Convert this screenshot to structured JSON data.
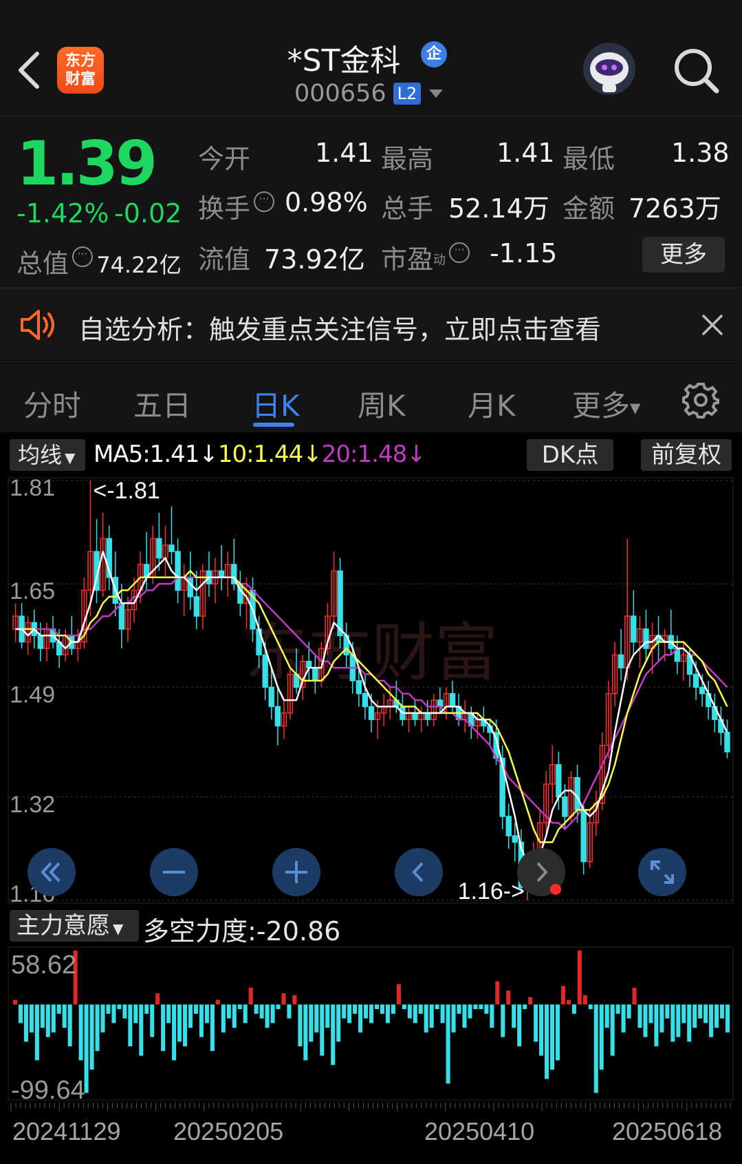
{
  "header": {
    "logo_text_line1": "东方",
    "logo_text_line2": "财富",
    "title": "*ST金科",
    "qi_badge": "企",
    "code": "000656",
    "level_badge": "L2",
    "icons": [
      "back-icon",
      "robot-avatar-icon",
      "search-icon"
    ]
  },
  "quote": {
    "price": "1.39",
    "change_pct": "-1.42%",
    "change": "-0.02",
    "open_label": "今开",
    "open": "1.41",
    "high_label": "最高",
    "high": "1.41",
    "low_label": "最低",
    "low": "1.38",
    "turnover_label": "换手",
    "turnover": "0.98%",
    "volume_label": "总手",
    "volume": "52.14万",
    "amount_label": "金额",
    "amount": "7263万",
    "mktcap_label": "总值",
    "mktcap": "74.22亿",
    "float_label": "流值",
    "float_cap": "73.92亿",
    "pe_label": "市盈",
    "pe_sup": "动",
    "pe": "-1.15",
    "more_button": "更多",
    "colors": {
      "down": "#1ed760",
      "up": "#ff3b30"
    }
  },
  "notice": {
    "text": "自选分析：触发重点关注信号，立即点击查看"
  },
  "tabs": {
    "items": [
      "分时",
      "五日",
      "日K",
      "周K",
      "月K",
      "更多"
    ],
    "active": "日K"
  },
  "chart_toolbar": {
    "ma_select": "均线",
    "ma5": "MA5:1.41↓",
    "ma10": "10:1.44↓",
    "ma20": "20:1.48↓",
    "dk_button": "DK点",
    "adjust_button": "前复权"
  },
  "indicator": {
    "select": "主力意愿",
    "value_text": "多空力度:-20.86"
  },
  "chart_data": [
    {
      "type": "candlestick",
      "y_ticks": [
        "1.81",
        "1.65",
        "1.49",
        "1.32",
        "1.16"
      ],
      "ylim": [
        1.16,
        1.81
      ],
      "annotations": [
        "<-1.81",
        "1.16->"
      ],
      "watermark": "东方财富",
      "series": [
        {
          "name": "MA5",
          "color": "#ffffff"
        },
        {
          "name": "MA10",
          "color": "#ffff4a"
        },
        {
          "name": "MA20",
          "color": "#c43ac4"
        }
      ],
      "ohlc": [
        [
          1.58,
          1.62,
          1.56,
          1.6
        ],
        [
          1.6,
          1.62,
          1.55,
          1.56
        ],
        [
          1.56,
          1.6,
          1.54,
          1.59
        ],
        [
          1.59,
          1.61,
          1.55,
          1.57
        ],
        [
          1.57,
          1.59,
          1.53,
          1.55
        ],
        [
          1.55,
          1.59,
          1.53,
          1.58
        ],
        [
          1.58,
          1.6,
          1.55,
          1.56
        ],
        [
          1.56,
          1.58,
          1.52,
          1.54
        ],
        [
          1.54,
          1.58,
          1.53,
          1.57
        ],
        [
          1.57,
          1.6,
          1.54,
          1.55
        ],
        [
          1.55,
          1.58,
          1.53,
          1.56
        ],
        [
          1.56,
          1.66,
          1.55,
          1.64
        ],
        [
          1.64,
          1.81,
          1.6,
          1.7
        ],
        [
          1.7,
          1.75,
          1.62,
          1.64
        ],
        [
          1.64,
          1.76,
          1.63,
          1.72
        ],
        [
          1.72,
          1.74,
          1.64,
          1.66
        ],
        [
          1.66,
          1.7,
          1.6,
          1.62
        ],
        [
          1.62,
          1.65,
          1.55,
          1.58
        ],
        [
          1.58,
          1.63,
          1.56,
          1.61
        ],
        [
          1.61,
          1.66,
          1.59,
          1.64
        ],
        [
          1.64,
          1.7,
          1.62,
          1.68
        ],
        [
          1.68,
          1.73,
          1.64,
          1.66
        ],
        [
          1.66,
          1.74,
          1.65,
          1.72
        ],
        [
          1.72,
          1.76,
          1.67,
          1.69
        ],
        [
          1.69,
          1.74,
          1.66,
          1.71
        ],
        [
          1.71,
          1.77,
          1.68,
          1.7
        ],
        [
          1.7,
          1.72,
          1.62,
          1.64
        ],
        [
          1.64,
          1.68,
          1.6,
          1.66
        ],
        [
          1.66,
          1.7,
          1.61,
          1.63
        ],
        [
          1.63,
          1.67,
          1.58,
          1.6
        ],
        [
          1.6,
          1.68,
          1.58,
          1.67
        ],
        [
          1.67,
          1.7,
          1.63,
          1.65
        ],
        [
          1.65,
          1.69,
          1.62,
          1.67
        ],
        [
          1.67,
          1.71,
          1.64,
          1.66
        ],
        [
          1.66,
          1.7,
          1.63,
          1.68
        ],
        [
          1.68,
          1.72,
          1.64,
          1.65
        ],
        [
          1.65,
          1.67,
          1.6,
          1.62
        ],
        [
          1.62,
          1.66,
          1.58,
          1.64
        ],
        [
          1.64,
          1.66,
          1.56,
          1.58
        ],
        [
          1.58,
          1.6,
          1.52,
          1.54
        ],
        [
          1.54,
          1.56,
          1.47,
          1.49
        ],
        [
          1.49,
          1.52,
          1.44,
          1.46
        ],
        [
          1.46,
          1.49,
          1.4,
          1.43
        ],
        [
          1.43,
          1.47,
          1.41,
          1.45
        ],
        [
          1.45,
          1.52,
          1.44,
          1.51
        ],
        [
          1.51,
          1.55,
          1.48,
          1.49
        ],
        [
          1.49,
          1.54,
          1.47,
          1.53
        ],
        [
          1.53,
          1.56,
          1.5,
          1.52
        ],
        [
          1.52,
          1.54,
          1.48,
          1.5
        ],
        [
          1.5,
          1.56,
          1.49,
          1.55
        ],
        [
          1.55,
          1.62,
          1.54,
          1.6
        ],
        [
          1.6,
          1.7,
          1.58,
          1.67
        ],
        [
          1.67,
          1.69,
          1.55,
          1.57
        ],
        [
          1.57,
          1.59,
          1.52,
          1.54
        ],
        [
          1.54,
          1.56,
          1.48,
          1.5
        ],
        [
          1.5,
          1.52,
          1.46,
          1.48
        ],
        [
          1.48,
          1.51,
          1.44,
          1.46
        ],
        [
          1.46,
          1.48,
          1.42,
          1.44
        ],
        [
          1.44,
          1.47,
          1.41,
          1.45
        ],
        [
          1.45,
          1.48,
          1.43,
          1.46
        ],
        [
          1.46,
          1.49,
          1.44,
          1.47
        ],
        [
          1.47,
          1.5,
          1.45,
          1.46
        ],
        [
          1.46,
          1.48,
          1.43,
          1.44
        ],
        [
          1.44,
          1.46,
          1.42,
          1.45
        ],
        [
          1.45,
          1.47,
          1.43,
          1.44
        ],
        [
          1.44,
          1.46,
          1.42,
          1.45
        ],
        [
          1.45,
          1.47,
          1.43,
          1.44
        ],
        [
          1.44,
          1.48,
          1.43,
          1.47
        ],
        [
          1.47,
          1.49,
          1.45,
          1.46
        ],
        [
          1.46,
          1.49,
          1.44,
          1.48
        ],
        [
          1.48,
          1.5,
          1.45,
          1.46
        ],
        [
          1.46,
          1.48,
          1.43,
          1.44
        ],
        [
          1.44,
          1.47,
          1.42,
          1.45
        ],
        [
          1.45,
          1.46,
          1.41,
          1.43
        ],
        [
          1.43,
          1.45,
          1.41,
          1.44
        ],
        [
          1.44,
          1.46,
          1.42,
          1.43
        ],
        [
          1.43,
          1.44,
          1.4,
          1.42
        ],
        [
          1.42,
          1.44,
          1.37,
          1.38
        ],
        [
          1.38,
          1.4,
          1.27,
          1.29
        ],
        [
          1.29,
          1.31,
          1.24,
          1.26
        ],
        [
          1.26,
          1.28,
          1.22,
          1.25
        ],
        [
          1.25,
          1.27,
          1.17,
          1.18
        ],
        [
          1.18,
          1.22,
          1.16,
          1.21
        ],
        [
          1.21,
          1.25,
          1.19,
          1.23
        ],
        [
          1.23,
          1.3,
          1.21,
          1.28
        ],
        [
          1.28,
          1.36,
          1.26,
          1.34
        ],
        [
          1.34,
          1.4,
          1.31,
          1.37
        ],
        [
          1.37,
          1.39,
          1.3,
          1.32
        ],
        [
          1.32,
          1.34,
          1.27,
          1.29
        ],
        [
          1.29,
          1.36,
          1.28,
          1.35
        ],
        [
          1.35,
          1.37,
          1.28,
          1.3
        ],
        [
          1.3,
          1.31,
          1.2,
          1.22
        ],
        [
          1.22,
          1.3,
          1.21,
          1.28
        ],
        [
          1.28,
          1.33,
          1.26,
          1.31
        ],
        [
          1.31,
          1.42,
          1.3,
          1.4
        ],
        [
          1.4,
          1.5,
          1.38,
          1.48
        ],
        [
          1.48,
          1.56,
          1.46,
          1.54
        ],
        [
          1.54,
          1.58,
          1.5,
          1.52
        ],
        [
          1.52,
          1.72,
          1.5,
          1.6
        ],
        [
          1.6,
          1.64,
          1.54,
          1.56
        ],
        [
          1.56,
          1.6,
          1.52,
          1.58
        ],
        [
          1.58,
          1.61,
          1.53,
          1.55
        ],
        [
          1.55,
          1.59,
          1.51,
          1.57
        ],
        [
          1.57,
          1.6,
          1.53,
          1.56
        ],
        [
          1.56,
          1.58,
          1.53,
          1.57
        ],
        [
          1.57,
          1.61,
          1.54,
          1.55
        ],
        [
          1.55,
          1.57,
          1.51,
          1.53
        ],
        [
          1.53,
          1.56,
          1.5,
          1.54
        ],
        [
          1.54,
          1.55,
          1.49,
          1.51
        ],
        [
          1.51,
          1.53,
          1.47,
          1.49
        ],
        [
          1.49,
          1.51,
          1.46,
          1.48
        ],
        [
          1.48,
          1.5,
          1.44,
          1.46
        ],
        [
          1.46,
          1.48,
          1.42,
          1.44
        ],
        [
          1.44,
          1.46,
          1.4,
          1.42
        ],
        [
          1.42,
          1.44,
          1.38,
          1.39
        ]
      ],
      "ma5": [
        1.58,
        1.58,
        1.57,
        1.58,
        1.57,
        1.57,
        1.57,
        1.56,
        1.55,
        1.56,
        1.56,
        1.59,
        1.62,
        1.66,
        1.7,
        1.67,
        1.64,
        1.62,
        1.62,
        1.62,
        1.64,
        1.66,
        1.67,
        1.68,
        1.69,
        1.67,
        1.66,
        1.66,
        1.65,
        1.64,
        1.65,
        1.66,
        1.66,
        1.66,
        1.66,
        1.66,
        1.64,
        1.63,
        1.61,
        1.58,
        1.55,
        1.52,
        1.49,
        1.47,
        1.47,
        1.47,
        1.5,
        1.52,
        1.52,
        1.52,
        1.56,
        1.59,
        1.58,
        1.57,
        1.55,
        1.52,
        1.49,
        1.47,
        1.46,
        1.46,
        1.46,
        1.46,
        1.45,
        1.45,
        1.45,
        1.45,
        1.45,
        1.45,
        1.45,
        1.46,
        1.46,
        1.46,
        1.45,
        1.45,
        1.44,
        1.44,
        1.43,
        1.41,
        1.37,
        1.33,
        1.29,
        1.24,
        1.22,
        1.22,
        1.23,
        1.26,
        1.3,
        1.32,
        1.33,
        1.33,
        1.32,
        1.3,
        1.29,
        1.3,
        1.33,
        1.36,
        1.42,
        1.47,
        1.52,
        1.54,
        1.55,
        1.56,
        1.56,
        1.57,
        1.56,
        1.56,
        1.55,
        1.55,
        1.54,
        1.52,
        1.5,
        1.48,
        1.46,
        1.44,
        1.42
      ],
      "ma10": [
        1.58,
        1.58,
        1.58,
        1.58,
        1.57,
        1.57,
        1.57,
        1.57,
        1.57,
        1.56,
        1.56,
        1.57,
        1.59,
        1.6,
        1.62,
        1.63,
        1.63,
        1.64,
        1.64,
        1.65,
        1.66,
        1.66,
        1.66,
        1.66,
        1.66,
        1.66,
        1.66,
        1.66,
        1.67,
        1.66,
        1.66,
        1.66,
        1.66,
        1.66,
        1.66,
        1.66,
        1.65,
        1.64,
        1.63,
        1.62,
        1.6,
        1.58,
        1.56,
        1.54,
        1.52,
        1.51,
        1.5,
        1.5,
        1.5,
        1.5,
        1.51,
        1.53,
        1.54,
        1.55,
        1.54,
        1.53,
        1.52,
        1.51,
        1.5,
        1.49,
        1.48,
        1.47,
        1.46,
        1.46,
        1.46,
        1.45,
        1.45,
        1.45,
        1.45,
        1.45,
        1.45,
        1.45,
        1.45,
        1.45,
        1.45,
        1.44,
        1.44,
        1.43,
        1.41,
        1.39,
        1.36,
        1.33,
        1.3,
        1.27,
        1.25,
        1.25,
        1.25,
        1.27,
        1.28,
        1.29,
        1.3,
        1.3,
        1.3,
        1.31,
        1.32,
        1.34,
        1.37,
        1.41,
        1.45,
        1.48,
        1.51,
        1.53,
        1.55,
        1.56,
        1.56,
        1.56,
        1.56,
        1.56,
        1.55,
        1.54,
        1.53,
        1.51,
        1.5,
        1.48,
        1.46
      ],
      "ma20": [
        1.58,
        1.58,
        1.58,
        1.58,
        1.58,
        1.58,
        1.58,
        1.57,
        1.57,
        1.57,
        1.57,
        1.58,
        1.58,
        1.59,
        1.6,
        1.6,
        1.61,
        1.62,
        1.62,
        1.63,
        1.63,
        1.64,
        1.64,
        1.65,
        1.65,
        1.65,
        1.66,
        1.66,
        1.66,
        1.66,
        1.66,
        1.66,
        1.66,
        1.66,
        1.66,
        1.66,
        1.65,
        1.65,
        1.64,
        1.63,
        1.62,
        1.61,
        1.6,
        1.59,
        1.58,
        1.57,
        1.56,
        1.55,
        1.54,
        1.53,
        1.53,
        1.52,
        1.52,
        1.52,
        1.52,
        1.52,
        1.51,
        1.51,
        1.5,
        1.5,
        1.49,
        1.49,
        1.48,
        1.48,
        1.47,
        1.47,
        1.46,
        1.46,
        1.46,
        1.45,
        1.45,
        1.44,
        1.44,
        1.43,
        1.42,
        1.41,
        1.4,
        1.38,
        1.37,
        1.35,
        1.34,
        1.33,
        1.32,
        1.31,
        1.3,
        1.29,
        1.28,
        1.28,
        1.27,
        1.28,
        1.29,
        1.31,
        1.33,
        1.35,
        1.37,
        1.39,
        1.41,
        1.43,
        1.45,
        1.47,
        1.49,
        1.51,
        1.52,
        1.53,
        1.54,
        1.54,
        1.55,
        1.55,
        1.54,
        1.54,
        1.53,
        1.52,
        1.51,
        1.5,
        1.49
      ]
    },
    {
      "type": "bar",
      "name": "主力意愿",
      "y_ticks": [
        "58.62",
        "-99.64"
      ],
      "ylim": [
        -99.64,
        58.62
      ],
      "x_tick_labels": [
        "20241129",
        "20250205",
        "20250410",
        "20250618"
      ],
      "values": [
        5,
        -20,
        -40,
        -30,
        -60,
        -25,
        -35,
        -30,
        -10,
        -25,
        -45,
        58,
        -60,
        -95,
        -70,
        -50,
        -30,
        -10,
        -20,
        -5,
        -15,
        -45,
        -20,
        -55,
        -10,
        -35,
        12,
        -50,
        -20,
        -60,
        -40,
        -45,
        -25,
        -10,
        -35,
        -20,
        -50,
        5,
        -30,
        -15,
        -25,
        -5,
        -20,
        18,
        -10,
        -15,
        -25,
        -20,
        -5,
        12,
        -15,
        10,
        -45,
        -60,
        -40,
        -30,
        -55,
        -25,
        -65,
        -40,
        -15,
        -20,
        -10,
        -30,
        -15,
        -20,
        -5,
        -10,
        -20,
        -10,
        22,
        -5,
        -15,
        -20,
        -10,
        -30,
        -25,
        -5,
        -20,
        -85,
        -30,
        -10,
        -25,
        -15,
        -5,
        -5,
        -10,
        -25,
        25,
        -35,
        15,
        -25,
        -45,
        -5,
        8,
        -40,
        -55,
        -80,
        -70,
        -60,
        20,
        5,
        -10,
        58,
        10,
        -5,
        -95,
        -70,
        -25,
        -55,
        -10,
        -30,
        -15,
        18,
        -25,
        -35,
        -20,
        -45,
        -30,
        -15,
        -40,
        -35,
        -20,
        -40,
        -25,
        -15,
        -20,
        -35,
        -25,
        -15,
        -30
      ]
    }
  ]
}
